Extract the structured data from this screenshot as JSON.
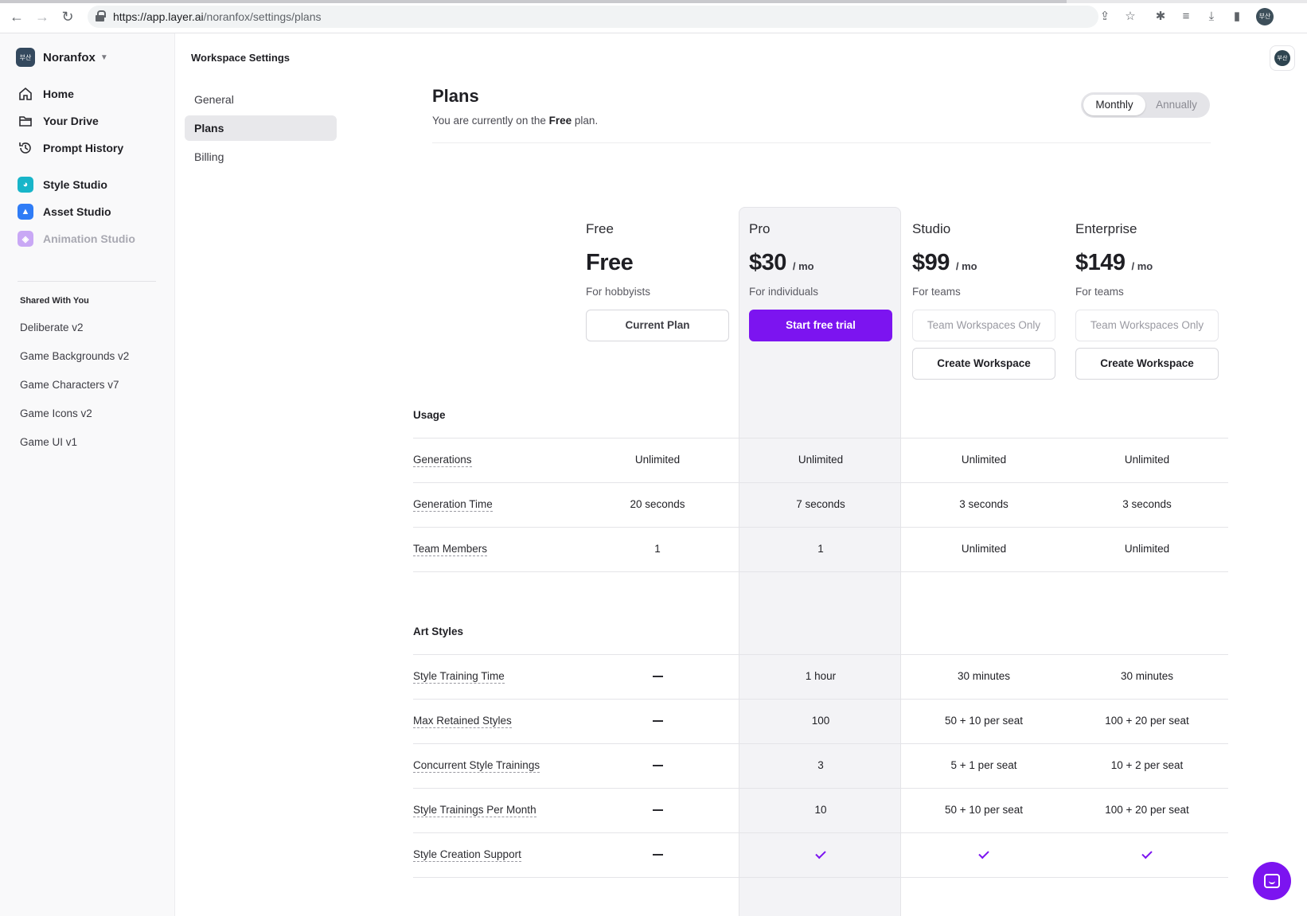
{
  "browser": {
    "url_domain": "https://app.layer.ai",
    "url_path": "/noranfox/settings/plans",
    "profile_initials": "부산"
  },
  "sidebar": {
    "workspace_initials": "부산",
    "workspace_name": "Noranfox",
    "nav": [
      {
        "label": "Home",
        "icon": "home-icon"
      },
      {
        "label": "Your Drive",
        "icon": "folder-icon"
      },
      {
        "label": "Prompt History",
        "icon": "history-icon"
      }
    ],
    "apps": [
      {
        "label": "Style Studio",
        "icon": "palette-icon",
        "color": "#18b5c9"
      },
      {
        "label": "Asset Studio",
        "icon": "image-icon",
        "color": "#2f7cf6"
      },
      {
        "label": "Animation Studio",
        "icon": "film-icon",
        "color": "#c9a8f5"
      }
    ],
    "shared_title": "Shared With You",
    "shared": [
      "Deliberate v2",
      "Game Backgrounds v2",
      "Game Characters v7",
      "Game Icons v2",
      "Game UI v1"
    ]
  },
  "settings_nav": {
    "title": "Workspace Settings",
    "items": [
      "General",
      "Plans",
      "Billing"
    ]
  },
  "header": {
    "title": "Plans",
    "sub_prefix": "You are currently on the",
    "sub_plan": "Free",
    "sub_suffix": "plan.",
    "toggle": [
      "Monthly",
      "Annually"
    ]
  },
  "plans": [
    {
      "name": "Free",
      "price": "Free",
      "per": "",
      "desc": "For hobbyists",
      "btn1": "Current Plan",
      "btn2": ""
    },
    {
      "name": "Pro",
      "price": "$30",
      "per": "/ mo",
      "desc": "For individuals",
      "btn1": "Start free trial",
      "btn2": ""
    },
    {
      "name": "Studio",
      "price": "$99",
      "per": "/ mo",
      "desc": "For teams",
      "btn1": "Team Workspaces Only",
      "btn2": "Create Workspace"
    },
    {
      "name": "Enterprise",
      "price": "$149",
      "per": "/ mo",
      "desc": "For teams",
      "btn1": "Team Workspaces Only",
      "btn2": "Create Workspace"
    }
  ],
  "usage": {
    "title": "Usage",
    "rows": [
      {
        "label": "Generations",
        "values": [
          "Unlimited",
          "Unlimited",
          "Unlimited",
          "Unlimited"
        ]
      },
      {
        "label": "Generation Time",
        "values": [
          "20 seconds",
          "7 seconds",
          "3 seconds",
          "3 seconds"
        ]
      },
      {
        "label": "Team Members",
        "values": [
          "1",
          "1",
          "Unlimited",
          "Unlimited"
        ]
      }
    ]
  },
  "art_styles": {
    "title": "Art Styles",
    "rows": [
      {
        "label": "Style Training Time",
        "values": [
          "—",
          "1 hour",
          "30 minutes",
          "30 minutes"
        ]
      },
      {
        "label": "Max Retained Styles",
        "values": [
          "—",
          "100",
          "50 + 10 per seat",
          "100 + 20 per seat"
        ]
      },
      {
        "label": "Concurrent Style Trainings",
        "values": [
          "—",
          "3",
          "5 + 1 per seat",
          "10 + 2 per seat"
        ]
      },
      {
        "label": "Style Trainings Per Month",
        "values": [
          "—",
          "10",
          "50 + 10 per seat",
          "100 + 20 per seat"
        ]
      },
      {
        "label": "Style Creation Support",
        "values": [
          "—",
          "✓",
          "✓",
          "✓"
        ]
      }
    ]
  },
  "colors": {
    "accent": "#7c14f0"
  }
}
